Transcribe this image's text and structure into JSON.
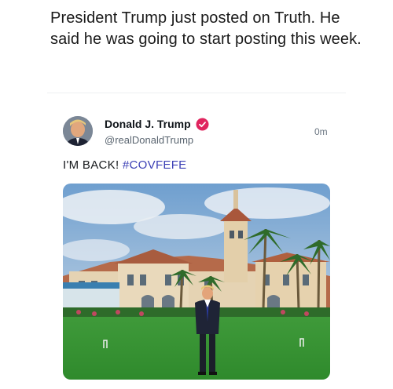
{
  "caption": "President Trump just posted on Truth. He said he was going to start posting this week.",
  "post": {
    "display_name": "Donald J. Trump",
    "handle": "@realDonaldTrump",
    "timestamp": "0m",
    "text": "I'M BACK!",
    "hashtag": "#COVFEFE",
    "verified_icon": "verified-check-icon",
    "accent_color": "#3b3fb5",
    "verified_color": "#e0245e"
  }
}
